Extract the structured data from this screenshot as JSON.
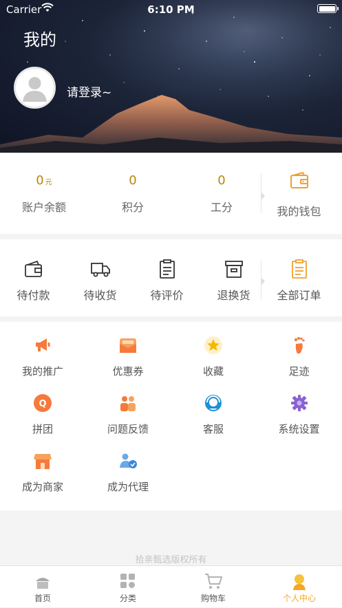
{
  "status_bar": {
    "carrier": "Carrier",
    "time": "6:10 PM"
  },
  "header": {
    "title": "我的",
    "login_prompt": "请登录~"
  },
  "stats": [
    {
      "value": "0",
      "unit": "元",
      "label": "账户余额"
    },
    {
      "value": "0",
      "unit": "",
      "label": "积分"
    },
    {
      "value": "0",
      "unit": "",
      "label": "工分"
    }
  ],
  "wallet": {
    "label": "我的钱包",
    "icon": "wallet-icon"
  },
  "orders": [
    {
      "label": "待付款",
      "icon": "wallet-outline-icon"
    },
    {
      "label": "待收货",
      "icon": "truck-icon"
    },
    {
      "label": "待评价",
      "icon": "clipboard-icon"
    },
    {
      "label": "退换货",
      "icon": "archive-box-icon"
    },
    {
      "label": "全部订单",
      "icon": "order-list-icon"
    }
  ],
  "services": [
    {
      "label": "我的推广",
      "icon": "megaphone-icon"
    },
    {
      "label": "优惠券",
      "icon": "coupon-icon"
    },
    {
      "label": "收藏",
      "icon": "star-icon"
    },
    {
      "label": "足迹",
      "icon": "footprint-icon"
    },
    {
      "label": "拼团",
      "icon": "group-buy-icon"
    },
    {
      "label": "问题反馈",
      "icon": "feedback-icon"
    },
    {
      "label": "客服",
      "icon": "customer-service-icon"
    },
    {
      "label": "系统设置",
      "icon": "settings-gear-icon"
    },
    {
      "label": "成为商家",
      "icon": "store-icon"
    },
    {
      "label": "成为代理",
      "icon": "agent-icon"
    }
  ],
  "footer": {
    "copyright": "拾亲甄选版权所有"
  },
  "tabbar": [
    {
      "label": "首页",
      "icon": "home-icon",
      "active": false
    },
    {
      "label": "分类",
      "icon": "category-icon",
      "active": false
    },
    {
      "label": "购物车",
      "icon": "cart-icon",
      "active": false
    },
    {
      "label": "个人中心",
      "icon": "profile-icon",
      "active": true
    }
  ],
  "colors": {
    "accent": "#f5a623",
    "stat_value": "#b8860b",
    "icon_orange": "#f57a3c"
  }
}
